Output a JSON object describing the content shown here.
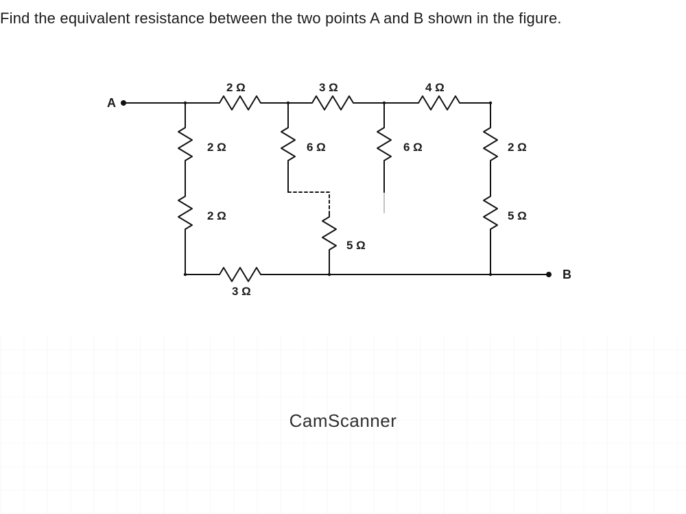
{
  "question": "Find the equivalent resistance between the two points A and B shown in the figure.",
  "nodes": {
    "A": "A",
    "B": "B"
  },
  "resistors": {
    "r_top_2": "2 Ω",
    "r_top_3": "3 Ω",
    "r_top_4": "4 Ω",
    "r_v_2a": "2 Ω",
    "r_v_2b": "2 Ω",
    "r_v_6a": "6 Ω",
    "r_v_6b": "6 Ω",
    "r_v_2c": "2 Ω",
    "r_v_5a": "5 Ω",
    "r_v_5b": "5 Ω",
    "r_bot_3": "3 Ω"
  },
  "watermark": "CamScanner"
}
